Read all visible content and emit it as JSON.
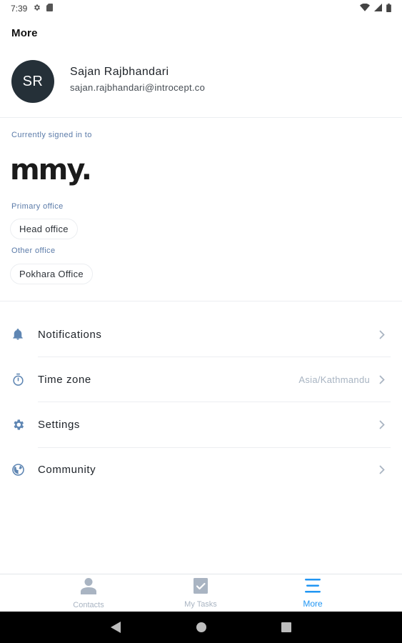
{
  "status_bar": {
    "time": "7:39"
  },
  "header": {
    "title": "More"
  },
  "profile": {
    "initials": "SR",
    "name": "Sajan Rajbhandari",
    "email": "sajan.rajbhandari@introcept.co"
  },
  "account": {
    "signed_in_label": "Currently signed in to",
    "logo_text": "mmy.",
    "primary_office_label": "Primary office",
    "primary_office": "Head office",
    "other_office_label": "Other office",
    "other_office": "Pokhara Office"
  },
  "menu": {
    "items": [
      {
        "label": "Notifications",
        "value": "",
        "icon": "bell-icon"
      },
      {
        "label": "Time zone",
        "value": "Asia/Kathmandu",
        "icon": "stopwatch-icon"
      },
      {
        "label": "Settings",
        "value": "",
        "icon": "gear-icon"
      },
      {
        "label": "Community",
        "value": "",
        "icon": "globe-icon"
      }
    ]
  },
  "bottom_nav": {
    "tabs": [
      {
        "label": "Contacts",
        "icon": "person-icon",
        "active": false
      },
      {
        "label": "My Tasks",
        "icon": "task-check-icon",
        "active": false
      },
      {
        "label": "More",
        "icon": "menu-icon",
        "active": true
      }
    ]
  },
  "colors": {
    "accent": "#2196f3",
    "icon": "#5f86b3",
    "inactive": "#a9b4c2",
    "avatar_bg": "#253038",
    "label": "#5a7aa8"
  }
}
